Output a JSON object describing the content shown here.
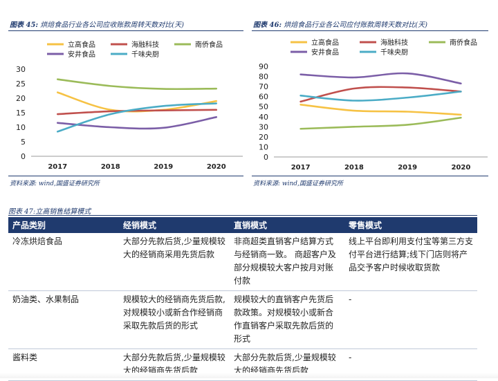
{
  "fig45": {
    "title_num": "图表 45:",
    "title_text": "烘焙食品行业各公司应收账款周转天数对比(天)",
    "source": "资料来源: wind,国盛证券研究所"
  },
  "fig46": {
    "title_num": "图表 46:",
    "title_text": "烘焙食品行业各公司应付账款周转天数对比(天)",
    "source": "资料来源: wind,国盛证券研究所"
  },
  "chart_data": [
    {
      "type": "line",
      "x": [
        "2017",
        "2018",
        "2019",
        "2020"
      ],
      "ylim": [
        0,
        30
      ],
      "yticks": [
        0,
        5,
        10,
        15,
        20,
        25,
        30
      ],
      "legend_position": "top",
      "grid": false,
      "series": [
        {
          "name": "立高食品",
          "color": "#f6c244",
          "values": [
            22,
            16,
            16,
            19
          ]
        },
        {
          "name": "海融科技",
          "color": "#c0504d",
          "values": [
            14.5,
            15.5,
            15.8,
            16
          ]
        },
        {
          "name": "南侨食品",
          "color": "#9bbb59",
          "values": [
            26.5,
            24.2,
            23.2,
            23.3
          ]
        },
        {
          "name": "安井食品",
          "color": "#7b5ea7",
          "values": [
            11.5,
            10,
            9.8,
            13.5
          ]
        },
        {
          "name": "千味央厨",
          "color": "#4bacc6",
          "values": [
            8.5,
            14.5,
            17.3,
            18.2
          ]
        }
      ]
    },
    {
      "type": "line",
      "x": [
        "2017",
        "2018",
        "2019",
        "2020"
      ],
      "ylim": [
        0,
        90
      ],
      "yticks": [
        0,
        10,
        20,
        30,
        40,
        50,
        60,
        70,
        80,
        90
      ],
      "legend_position": "top",
      "grid": false,
      "series": [
        {
          "name": "立高食品",
          "color": "#f6c244",
          "values": [
            52,
            46,
            45,
            42
          ]
        },
        {
          "name": "海融科技",
          "color": "#c0504d",
          "values": [
            55,
            68,
            69,
            65
          ]
        },
        {
          "name": "南侨食品",
          "color": "#9bbb59",
          "values": [
            28,
            30,
            32,
            39
          ]
        },
        {
          "name": "安井食品",
          "color": "#7b5ea7",
          "values": [
            82,
            79,
            83,
            73
          ]
        },
        {
          "name": "千味央厨",
          "color": "#4bacc6",
          "values": [
            61,
            56,
            59,
            65
          ]
        }
      ]
    }
  ],
  "table": {
    "title": "图表 47:立高销售结算模式",
    "headers": [
      "产品类别",
      "经销模式",
      "直销模式",
      "零售模式"
    ],
    "rows": [
      [
        "冷冻烘焙食品",
        "大部分先款后货,少量规模较大的经销商采用先货后款",
        "非商超类直销客户结算方式与经销商一致。 商超客户及部分规模较大客户按月对账付款",
        "线上平台即利用支付宝等第三方支付平台进行结算;线下门店则将产品交予客户时候收取货款"
      ],
      [
        "奶油类、水果制品",
        "规模较大的经销商先货后款,对规模较小或新合作经销商采取先款后货的形式",
        "规模较大的直销客户先货后款政策。对规模较小或新合作直销客户采取先款后货的形式",
        "-"
      ],
      [
        "酱料类",
        "大部分先款后货,少量规模较大的经销商先货后款",
        "大部分先款后货,少量规模较大的经销商先货后款",
        "-"
      ]
    ]
  }
}
